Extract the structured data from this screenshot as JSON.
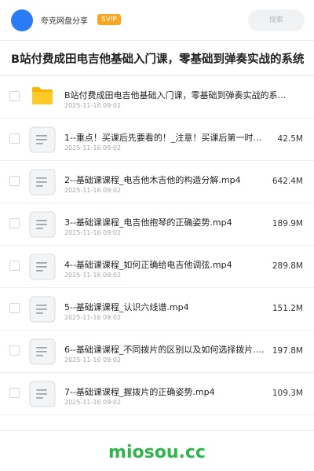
{
  "header": {
    "user_name": "夸克网盘分享",
    "vip_label": "SVIP",
    "search_placeholder": "搜索",
    "colors": {
      "avatar": "#2b7bf6",
      "vip_badge": "#f6a623"
    }
  },
  "page_title": "B站付费成田电吉他基础入门课，零基础到弹奏实战的系统",
  "files": [
    {
      "type": "folder",
      "icon": "folder-icon",
      "name": "B站付费成田电吉他基础入门课，零基础到弹奏实战的系统教程",
      "date": "2025-11-16 09:02",
      "size": ""
    },
    {
      "type": "file",
      "icon": "document-icon",
      "name": "1--重点！买课后先要看的！_注意！买课后第一时间…",
      "date": "2025-11-16 09:02",
      "size": "42.5M"
    },
    {
      "type": "file",
      "icon": "document-icon",
      "name": "2--基础课课程_电吉他木吉他的构造分解.mp4",
      "date": "2025-11-16 09:02",
      "size": "642.4M"
    },
    {
      "type": "file",
      "icon": "document-icon",
      "name": "3--基础课课程_电吉他抱琴的正确姿势.mp4",
      "date": "2025-11-16 09:02",
      "size": "189.9M"
    },
    {
      "type": "file",
      "icon": "document-icon",
      "name": "4--基础课课程_如何正确给电吉他调弦.mp4",
      "date": "2025-11-16 09:02",
      "size": "289.8M"
    },
    {
      "type": "file",
      "icon": "document-icon",
      "name": "5--基础课课程_认识六线谱.mp4",
      "date": "2025-11-16 09:02",
      "size": "151.2M"
    },
    {
      "type": "file",
      "icon": "document-icon",
      "name": "6--基础课课程_不同拨片的区别以及如何选择拨片.…",
      "date": "2025-11-16 09:02",
      "size": "197.8M"
    },
    {
      "type": "file",
      "icon": "document-icon",
      "name": "7--基础课课程_握拨片的正确姿势.mp4",
      "date": "2025-11-16 09:02",
      "size": "109.3M"
    }
  ],
  "watermark": {
    "text": "miosou.cc",
    "color": "#2fb54b"
  }
}
